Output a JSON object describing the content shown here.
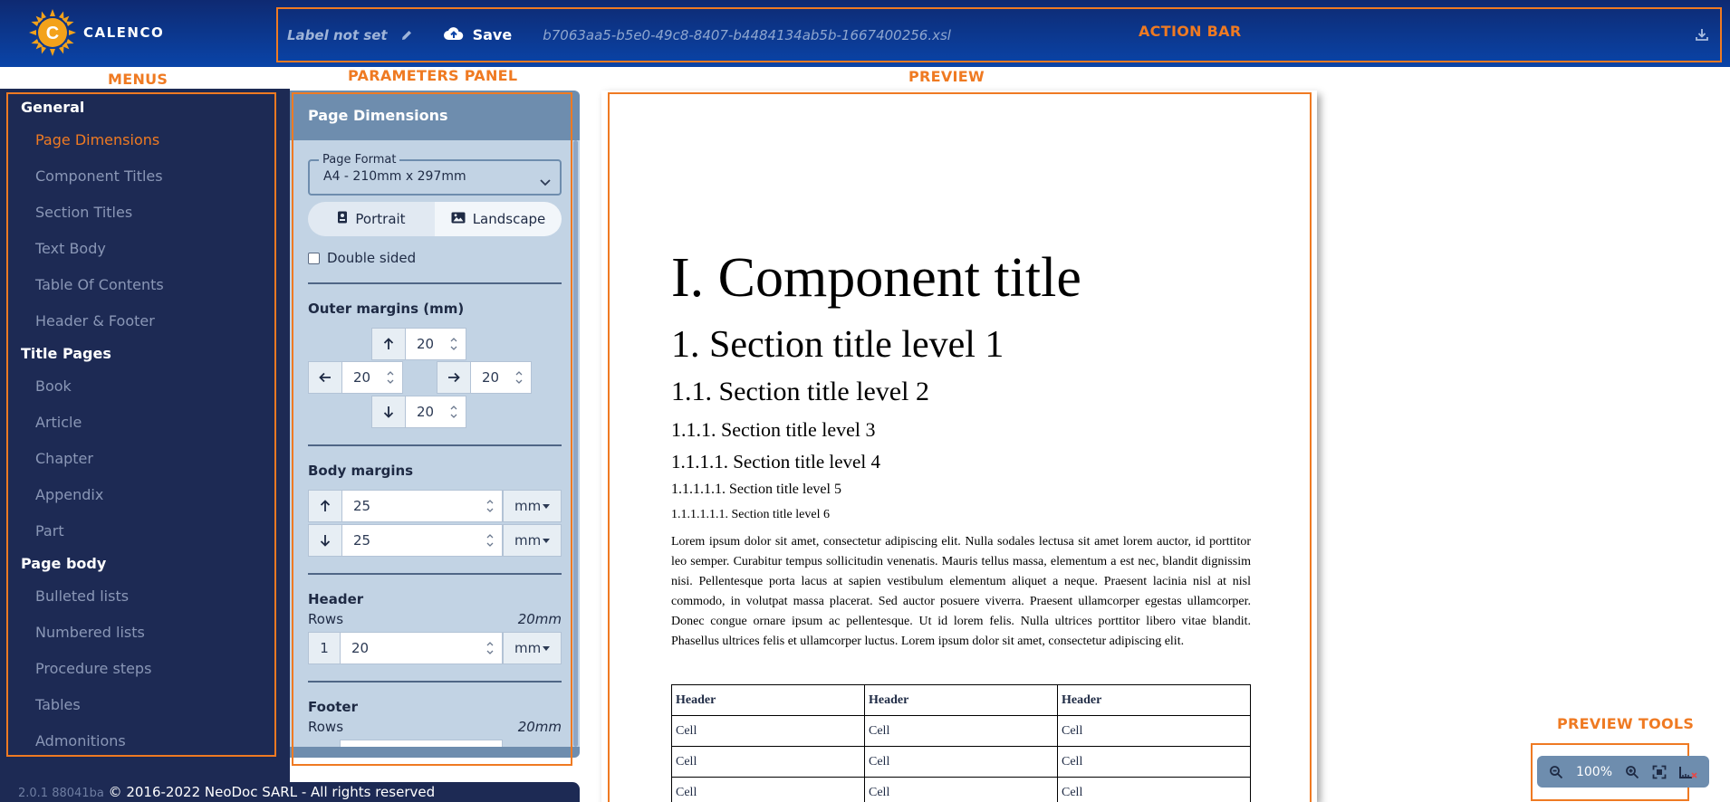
{
  "app": {
    "brand": "CALENCO"
  },
  "action_bar": {
    "label": "Label not set",
    "save_label": "Save",
    "filename": "b7063aa5-b5e0-49c8-8407-b4484134ab5b-1667400256.xsl"
  },
  "annotations": {
    "action_bar": "ACTION BAR",
    "menus": "MENUS",
    "parameters_panel": "PARAMETERS PANEL",
    "preview": "PREVIEW",
    "preview_tools": "PREVIEW TOOLS"
  },
  "menu": {
    "groups": [
      {
        "label": "General",
        "items": [
          "Page Dimensions",
          "Component Titles",
          "Section Titles",
          "Text Body",
          "Table Of Contents",
          "Header & Footer"
        ]
      },
      {
        "label": "Title Pages",
        "items": [
          "Book",
          "Article",
          "Chapter",
          "Appendix",
          "Part"
        ]
      },
      {
        "label": "Page body",
        "items": [
          "Bulleted lists",
          "Numbered lists",
          "Procedure steps",
          "Tables",
          "Admonitions"
        ]
      }
    ],
    "active": "Page Dimensions"
  },
  "footer": {
    "version": "2.0.1 88041ba",
    "copyright": "© 2016-2022 NeoDoc SARL - All rights reserved"
  },
  "params": {
    "title": "Page Dimensions",
    "page_format": {
      "legend": "Page Format",
      "value": "A4 - 210mm x 297mm"
    },
    "orientation": {
      "portrait": "Portrait",
      "landscape": "Landscape"
    },
    "double_sided": "Double sided",
    "outer_margins": {
      "title": "Outer margins (mm)",
      "top": "20",
      "left": "20",
      "right": "20",
      "bottom": "20"
    },
    "body_margins": {
      "title": "Body margins",
      "top": "25",
      "bottom": "25",
      "unit": "mm"
    },
    "header": {
      "title": "Header",
      "rows_label": "Rows",
      "rows_value": "20mm",
      "row_index": "1",
      "value": "20",
      "unit": "mm"
    },
    "footer": {
      "title": "Footer",
      "rows_label": "Rows",
      "rows_value": "20mm"
    }
  },
  "preview": {
    "component_title": "I. Component title",
    "section_titles": [
      "1. Section title level 1",
      "1.1. Section title level 2",
      "1.1.1. Section title level 3",
      "1.1.1.1. Section title level 4",
      "1.1.1.1.1. Section title level 5",
      "1.1.1.1.1.1. Section title level 6"
    ],
    "body": "Lorem ipsum dolor sit amet, consectetur adipiscing elit. Nulla sodales lectusa sit amet lorem auctor, id porttitor leo semper. Curabitur tempus sollicitudin venenatis. Mauris tellus massa, elementum a est nec, blandit dignissim nisi. Pellentesque porta lacus at sapien vestibulum elementum aliquet a neque. Praesent lacinia nisl at nisl commodo, in volutpat massa placerat. Sed auctor posuere viverra. Praesent ullamcorper egestas ullamcorper. Donec congue ornare ipsum ac pellentesque. Ut id lorem felis. Nulla ultrices porttitor libero vitae blandit. Phasellus ultrices felis et ullamcorper luctus. Lorem ipsum dolor sit amet, consectetur adipiscing elit.",
    "table": {
      "headers": [
        "Header",
        "Header",
        "Header"
      ],
      "rows": [
        [
          "Cell",
          "Cell",
          "Cell"
        ],
        [
          "Cell",
          "Cell",
          "Cell"
        ],
        [
          "Cell",
          "Cell",
          "Cell"
        ]
      ]
    }
  },
  "tools": {
    "zoom": "100%"
  },
  "colors": {
    "accent": "#ef7a22",
    "topbar": "#0a44a8",
    "menu_bg": "#1d2a54",
    "panel_bg": "#c2d3e4",
    "panel_head": "#6e8dae"
  },
  "icons": [
    "pencil-icon",
    "cloud-upload-icon",
    "download-icon",
    "portrait-icon",
    "image-icon",
    "arrow-up-icon",
    "arrow-down-icon",
    "arrow-left-icon",
    "arrow-right-icon",
    "chevron-down-icon",
    "zoom-out-icon",
    "zoom-in-icon",
    "fit-screen-icon",
    "ruler-icon"
  ]
}
